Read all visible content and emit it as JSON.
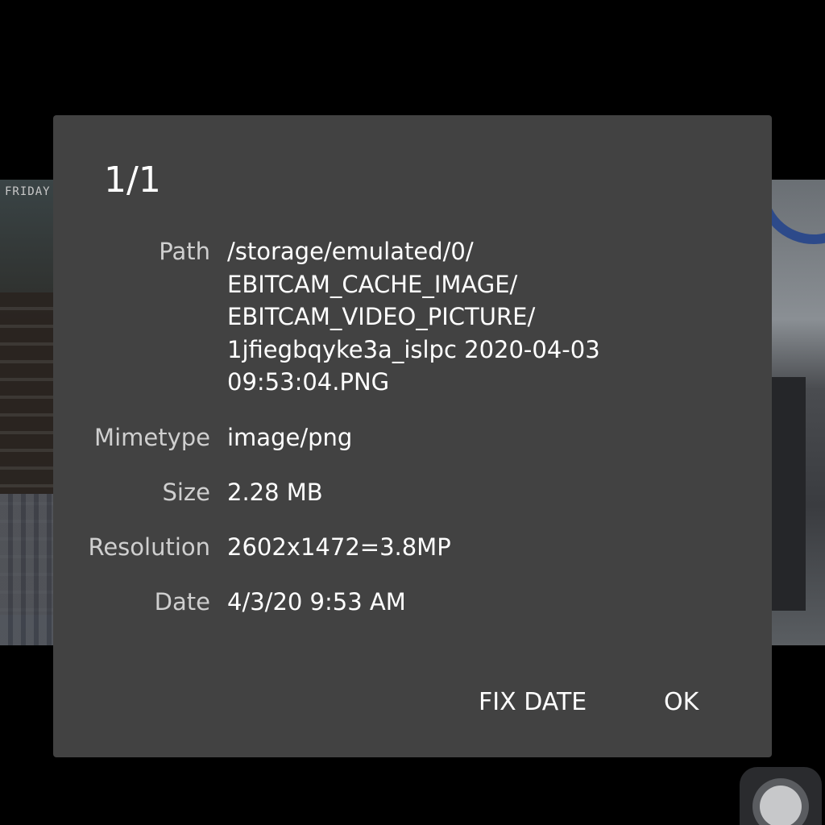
{
  "background": {
    "timestamp_overlay": "FRIDAY"
  },
  "dialog": {
    "title": "1/1",
    "rows": [
      {
        "label": "Path",
        "value": "/storage/emulated/0/\nEBITCAM_CACHE_IMAGE/\nEBITCAM_VIDEO_PICTURE/\n1jfiegbqyke3a_islpc 2020-04-03\n09:53:04.PNG"
      },
      {
        "label": "Mimetype",
        "value": "image/png"
      },
      {
        "label": "Size",
        "value": "2.28 MB"
      },
      {
        "label": "Resolution",
        "value": "2602x1472=3.8MP"
      },
      {
        "label": "Date",
        "value": "4/3/20 9:53 AM"
      }
    ],
    "buttons": {
      "fix_date": "FIX DATE",
      "ok": "OK"
    }
  },
  "colors": {
    "dialog_bg": "#424242",
    "label": "#cfcfcf",
    "value": "#ffffff"
  },
  "icons": {
    "shutter": "shutter-button-icon"
  }
}
